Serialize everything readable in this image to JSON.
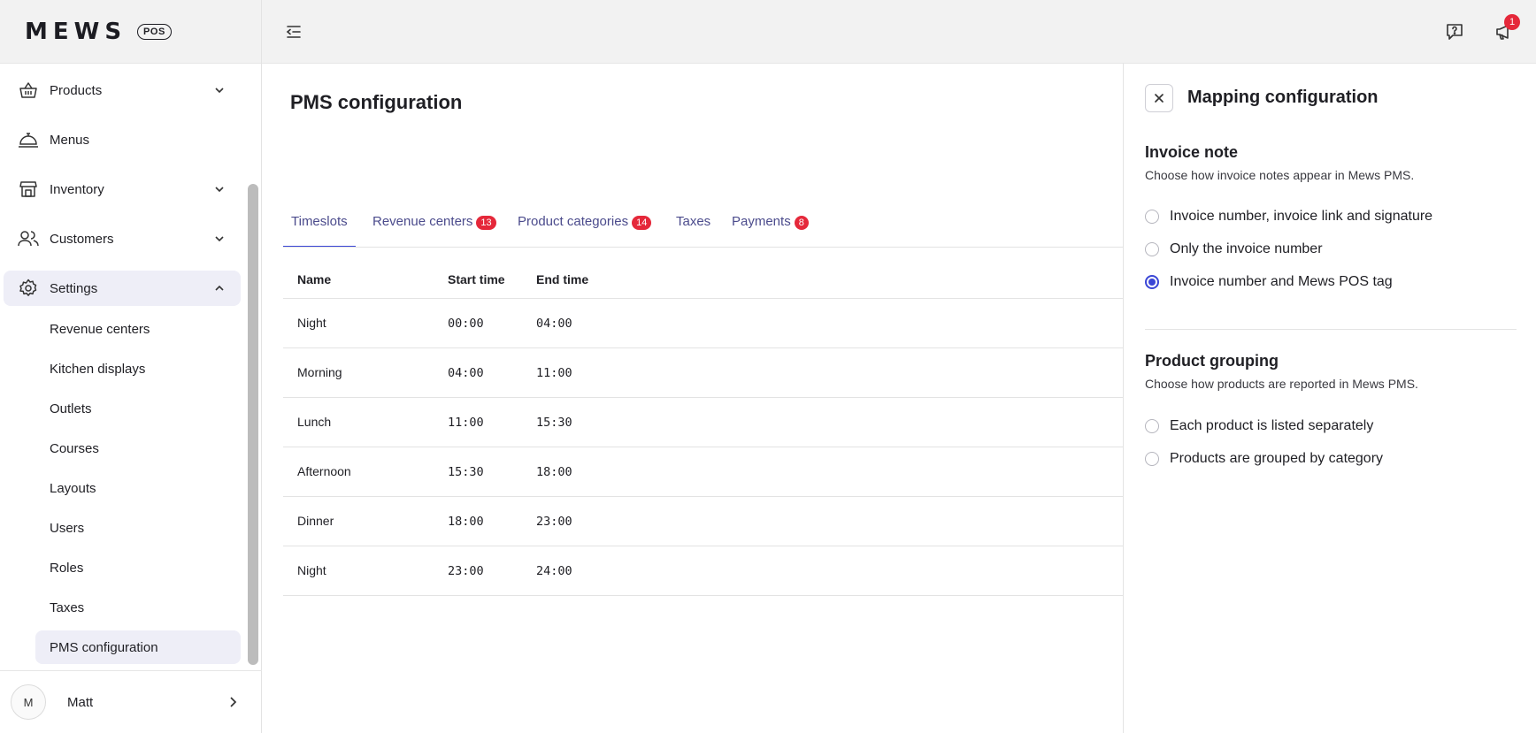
{
  "brand": {
    "name": "MEWS",
    "badge": "POS"
  },
  "topbar": {
    "notifications_count": "1"
  },
  "sidebar": {
    "items": [
      {
        "label": "Products"
      },
      {
        "label": "Menus"
      },
      {
        "label": "Inventory"
      },
      {
        "label": "Customers"
      },
      {
        "label": "Settings"
      }
    ],
    "settings_sub": [
      {
        "label": "Revenue centers"
      },
      {
        "label": "Kitchen displays"
      },
      {
        "label": "Outlets"
      },
      {
        "label": "Courses"
      },
      {
        "label": "Layouts"
      },
      {
        "label": "Users"
      },
      {
        "label": "Roles"
      },
      {
        "label": "Taxes"
      },
      {
        "label": "PMS configuration"
      }
    ],
    "user": {
      "initial": "M",
      "name": "Matt"
    }
  },
  "main": {
    "title": "PMS configuration",
    "tabs": [
      {
        "label": "Timeslots",
        "badge": ""
      },
      {
        "label": "Revenue centers",
        "badge": "13"
      },
      {
        "label": "Product categories",
        "badge": "14"
      },
      {
        "label": "Taxes",
        "badge": ""
      },
      {
        "label": "Payments",
        "badge": "8"
      }
    ],
    "table": {
      "headers": [
        "Name",
        "Start time",
        "End time"
      ],
      "rows": [
        {
          "name": "Night",
          "start": "00:00",
          "end": "04:00"
        },
        {
          "name": "Morning",
          "start": "04:00",
          "end": "11:00"
        },
        {
          "name": "Lunch",
          "start": "11:00",
          "end": "15:30"
        },
        {
          "name": "Afternoon",
          "start": "15:30",
          "end": "18:00"
        },
        {
          "name": "Dinner",
          "start": "18:00",
          "end": "23:00"
        },
        {
          "name": "Night",
          "start": "23:00",
          "end": "24:00"
        }
      ]
    }
  },
  "panel": {
    "title": "Mapping configuration",
    "invoice_note": {
      "title": "Invoice note",
      "description": "Choose how invoice notes appear in Mews PMS.",
      "options": [
        "Invoice number, invoice link and signature",
        "Only the invoice number",
        "Invoice number and Mews POS tag"
      ],
      "selected": "Invoice number and Mews POS tag"
    },
    "product_grouping": {
      "title": "Product grouping",
      "description": "Choose how products are reported in Mews PMS.",
      "options": [
        "Each product is listed separately",
        "Products are grouped by category"
      ],
      "selected": ""
    }
  },
  "colors": {
    "accent": "#3a46d6",
    "badge": "#e5283a",
    "tab_text": "#4b4b8c",
    "active_bg": "#eeeef7"
  }
}
